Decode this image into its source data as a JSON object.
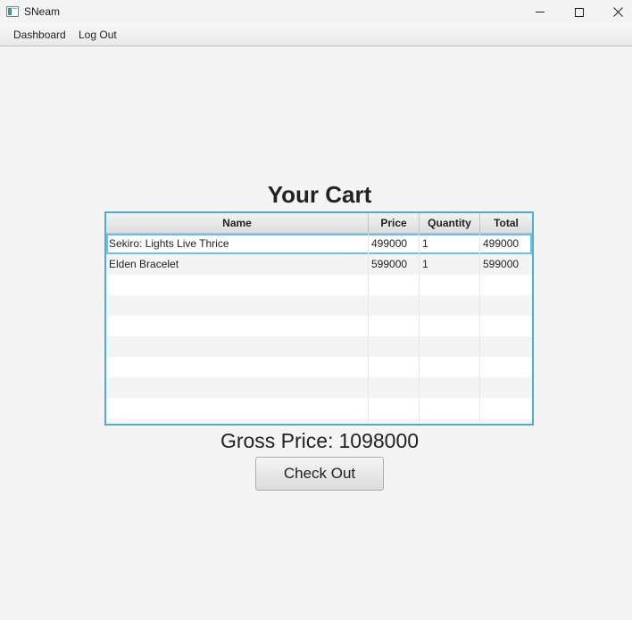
{
  "window": {
    "title": "SNeam"
  },
  "menu": {
    "items": [
      {
        "label": "Dashboard"
      },
      {
        "label": "Log Out"
      }
    ]
  },
  "cart": {
    "heading": "Your Cart",
    "columns": [
      "Name",
      "Price",
      "Quantity",
      "Total"
    ],
    "rows": [
      {
        "name": "Sekiro: Lights Live Thrice",
        "price": "499000",
        "quantity": "1",
        "total": "499000"
      },
      {
        "name": "Elden Bracelet",
        "price": "599000",
        "quantity": "1",
        "total": "599000"
      }
    ],
    "selected_row": 0
  },
  "summary": {
    "gross_label": "Gross Price:",
    "gross_value": "1098000"
  },
  "actions": {
    "checkout_label": "Check Out"
  },
  "icons": [
    "app-icon",
    "minimize-icon",
    "maximize-icon",
    "close-icon"
  ],
  "colors": {
    "table_border": "#4aaed7",
    "selection_outline": "#6ec1e4"
  }
}
